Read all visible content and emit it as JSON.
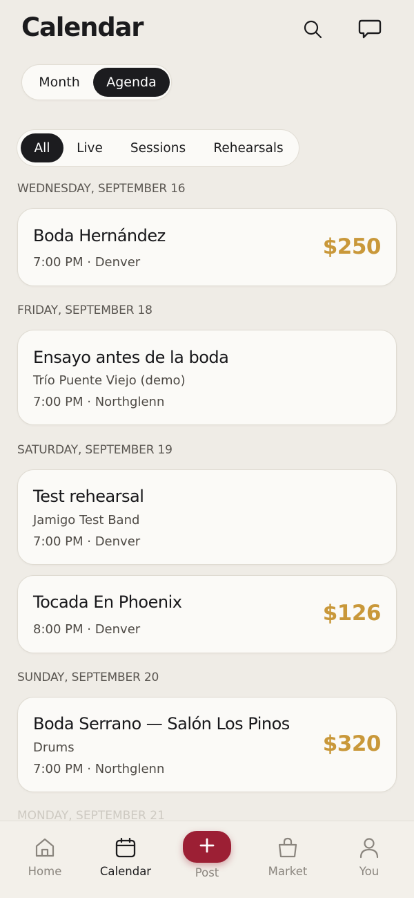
{
  "header": {
    "title": "Calendar",
    "icons": [
      "search-icon",
      "chat-icon"
    ]
  },
  "view_toggle": {
    "options": [
      "Month",
      "Agenda"
    ],
    "selected": "Agenda"
  },
  "filters": {
    "options": [
      "All",
      "Live",
      "Sessions",
      "Rehearsals"
    ],
    "selected": "All"
  },
  "agenda": [
    {
      "day": "WEDNESDAY, SEPTEMBER 16",
      "events": [
        {
          "title": "Boda Hernández",
          "subtitle": "",
          "details": "7:00 PM · Denver",
          "price": "$250"
        }
      ]
    },
    {
      "day": "FRIDAY, SEPTEMBER 18",
      "events": [
        {
          "title": "Ensayo antes de la boda",
          "subtitle": "Trío Puente Viejo (demo)",
          "details": "7:00 PM · Northglenn",
          "price": ""
        }
      ]
    },
    {
      "day": "SATURDAY, SEPTEMBER 19",
      "events": [
        {
          "title": "Test rehearsal",
          "subtitle": "Jamigo Test Band",
          "details": "7:00 PM · Denver",
          "price": ""
        },
        {
          "title": "Tocada En Phoenix",
          "subtitle": "",
          "details": "8:00 PM · Denver",
          "price": "$126"
        }
      ]
    },
    {
      "day": "SUNDAY, SEPTEMBER 20",
      "events": [
        {
          "title": "Boda Serrano — Salón Los Pinos",
          "subtitle": "Drums",
          "details": "7:00 PM · Northglenn",
          "price": "$320"
        }
      ]
    }
  ],
  "next_day_label": "MONDAY, SEPTEMBER 21",
  "tabbar": {
    "items": [
      {
        "label": "Home",
        "icon": "home-icon"
      },
      {
        "label": "Calendar",
        "icon": "calendar-icon"
      },
      {
        "label": "Post",
        "icon": "plus-icon"
      },
      {
        "label": "Market",
        "icon": "shopping-bag-icon"
      },
      {
        "label": "You",
        "icon": "user-icon"
      }
    ],
    "active": "Calendar"
  },
  "colors": {
    "accent_price": "#c9983a",
    "post_button": "#9c1f34",
    "active_chip": "#1c1c1f",
    "background": "#efece6"
  }
}
